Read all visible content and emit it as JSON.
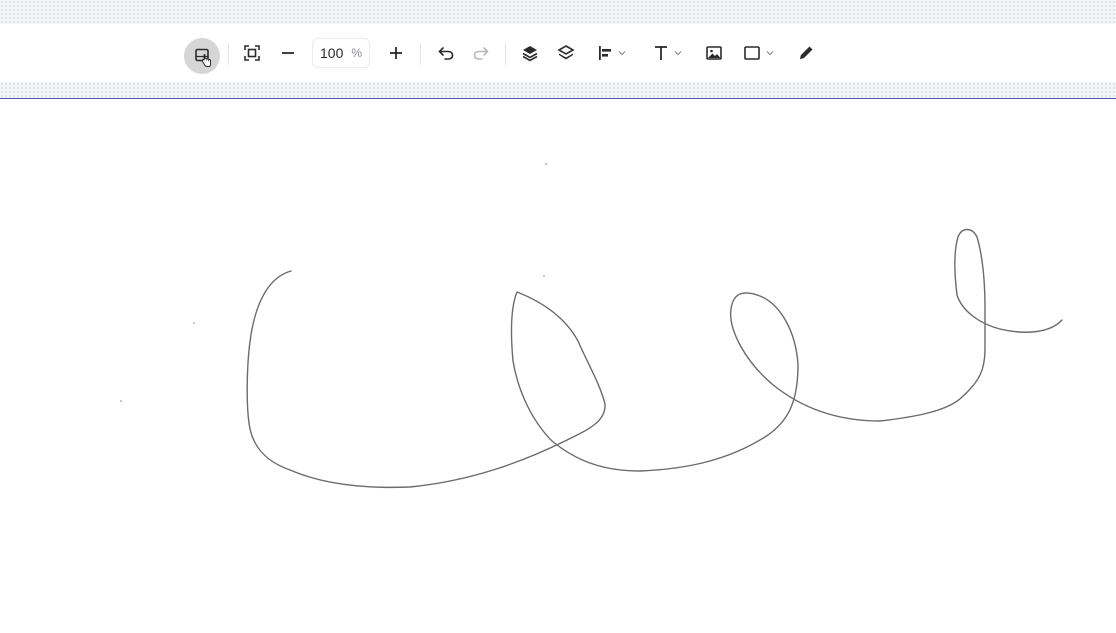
{
  "toolbar": {
    "zoom_value": "100",
    "zoom_unit": "%",
    "items": [
      {
        "name": "present-icon",
        "active": true
      },
      {
        "name": "fit-to-screen-icon"
      },
      {
        "name": "zoom-out-icon"
      },
      {
        "name": "zoom-in-icon"
      },
      {
        "name": "undo-icon"
      },
      {
        "name": "redo-icon",
        "disabled": true
      },
      {
        "name": "layer-up-icon"
      },
      {
        "name": "layers-icon"
      },
      {
        "name": "align-left-icon"
      },
      {
        "name": "text-icon"
      },
      {
        "name": "image-icon"
      },
      {
        "name": "rectangle-icon"
      },
      {
        "name": "pencil-icon"
      }
    ]
  },
  "colors": {
    "stroke": "#6b6b6b",
    "divider": "#5a55b5",
    "active_bg": "#d6d6d6",
    "icon": "#2b2b2b",
    "disabled_icon": "#b8b8bd"
  }
}
